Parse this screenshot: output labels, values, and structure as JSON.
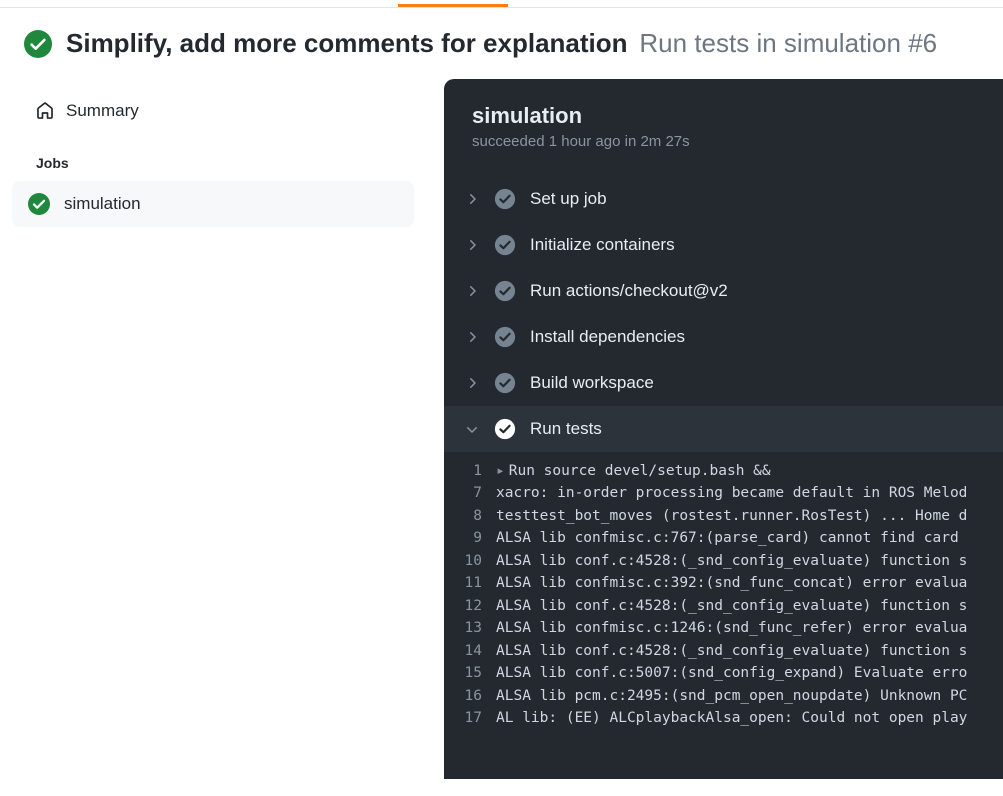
{
  "header": {
    "title": "Simplify, add more comments for explanation",
    "subtitle": "Run tests in simulation #6"
  },
  "sidebar": {
    "summary_label": "Summary",
    "jobs_heading": "Jobs",
    "jobs": [
      {
        "name": "simulation"
      }
    ]
  },
  "panel": {
    "title": "simulation",
    "status_line": "succeeded 1 hour ago in 2m 27s",
    "steps": [
      {
        "name": "Set up job",
        "expanded": false
      },
      {
        "name": "Initialize containers",
        "expanded": false
      },
      {
        "name": "Run actions/checkout@v2",
        "expanded": false
      },
      {
        "name": "Install dependencies",
        "expanded": false
      },
      {
        "name": "Build workspace",
        "expanded": false
      },
      {
        "name": "Run tests",
        "expanded": true
      }
    ],
    "log": [
      {
        "n": "1",
        "caret": true,
        "t": "Run source devel/setup.bash &&"
      },
      {
        "n": "7",
        "t": "xacro: in-order processing became default in ROS Melod"
      },
      {
        "n": "8",
        "t": "testtest_bot_moves (rostest.runner.RosTest) ... Home d"
      },
      {
        "n": "9",
        "t": "ALSA lib confmisc.c:767:(parse_card) cannot find card "
      },
      {
        "n": "10",
        "t": "ALSA lib conf.c:4528:(_snd_config_evaluate) function s"
      },
      {
        "n": "11",
        "t": "ALSA lib confmisc.c:392:(snd_func_concat) error evalua"
      },
      {
        "n": "12",
        "t": "ALSA lib conf.c:4528:(_snd_config_evaluate) function s"
      },
      {
        "n": "13",
        "t": "ALSA lib confmisc.c:1246:(snd_func_refer) error evalua"
      },
      {
        "n": "14",
        "t": "ALSA lib conf.c:4528:(_snd_config_evaluate) function s"
      },
      {
        "n": "15",
        "t": "ALSA lib conf.c:5007:(snd_config_expand) Evaluate erro"
      },
      {
        "n": "16",
        "t": "ALSA lib pcm.c:2495:(snd_pcm_open_noupdate) Unknown PC"
      },
      {
        "n": "17",
        "t": "AL lib: (EE) ALCplaybackAlsa_open: Could not open play"
      }
    ]
  }
}
